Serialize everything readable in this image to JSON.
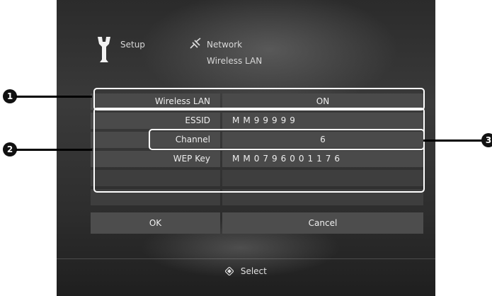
{
  "breadcrumb": {
    "setup": "Setup",
    "network": "Network",
    "wireless_lan": "Wireless LAN"
  },
  "settings": [
    {
      "label": "Wireless LAN",
      "value": "ON"
    },
    {
      "label": "ESSID",
      "value": "MM99999"
    },
    {
      "label": "Channel",
      "value": "6"
    },
    {
      "label": "WEP Key",
      "value": "MM0796001176"
    }
  ],
  "buttons": {
    "ok": "OK",
    "cancel": "Cancel"
  },
  "footer": {
    "select_hint": "Select"
  },
  "callouts": [
    "1",
    "2",
    "3"
  ],
  "icons": {
    "setup": "wrench-icon",
    "network": "network-plug-icon",
    "select": "dpad-select-icon"
  }
}
